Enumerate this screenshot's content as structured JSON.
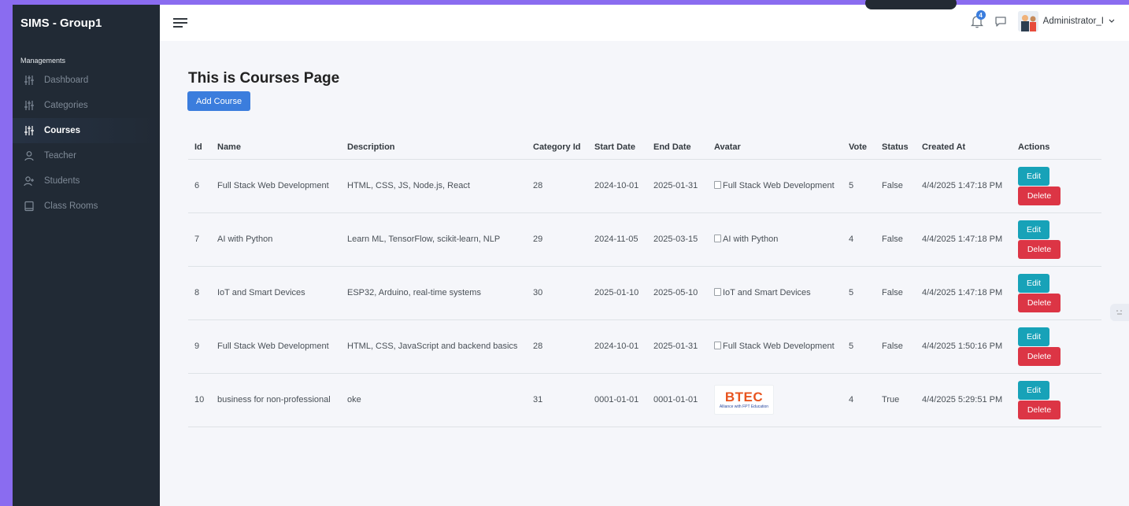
{
  "sidebar": {
    "brand": "SIMS - Group1",
    "section_label": "Managements",
    "items": [
      {
        "label": "Dashboard",
        "icon": "sliders-icon",
        "active": false
      },
      {
        "label": "Categories",
        "icon": "sliders-icon",
        "active": false
      },
      {
        "label": "Courses",
        "icon": "sliders-icon",
        "active": true
      },
      {
        "label": "Teacher",
        "icon": "user-icon",
        "active": false
      },
      {
        "label": "Students",
        "icon": "user-plus-icon",
        "active": false
      },
      {
        "label": "Class Rooms",
        "icon": "book-icon",
        "active": false
      }
    ]
  },
  "topbar": {
    "notification_count": "4",
    "user_name": "Administrator_I"
  },
  "main": {
    "title": "This is Courses Page",
    "add_button": "Add Course",
    "table": {
      "headers": [
        "Id",
        "Name",
        "Description",
        "Category Id",
        "Start Date",
        "End Date",
        "Avatar",
        "Vote",
        "Status",
        "Created At",
        "Actions"
      ],
      "rows": [
        {
          "id": "6",
          "name": "Full Stack Web Development",
          "description": "HTML, CSS, JS, Node.js, React",
          "category_id": "28",
          "start_date": "2024-10-01",
          "end_date": "2025-01-31",
          "avatar_alt": "Full Stack Web Development",
          "vote": "5",
          "status": "False",
          "created_at": "4/4/2025 1:47:18 PM"
        },
        {
          "id": "7",
          "name": "AI with Python",
          "description": "Learn ML, TensorFlow, scikit-learn, NLP",
          "category_id": "29",
          "start_date": "2024-11-05",
          "end_date": "2025-03-15",
          "avatar_alt": "AI with Python",
          "vote": "4",
          "status": "False",
          "created_at": "4/4/2025 1:47:18 PM"
        },
        {
          "id": "8",
          "name": "IoT and Smart Devices",
          "description": "ESP32, Arduino, real-time systems",
          "category_id": "30",
          "start_date": "2025-01-10",
          "end_date": "2025-05-10",
          "avatar_alt": "IoT and Smart Devices",
          "vote": "5",
          "status": "False",
          "created_at": "4/4/2025 1:47:18 PM"
        },
        {
          "id": "9",
          "name": "Full Stack Web Development",
          "description": "HTML, CSS, JavaScript and backend basics",
          "category_id": "28",
          "start_date": "2024-10-01",
          "end_date": "2025-01-31",
          "avatar_alt": "Full Stack Web Development",
          "vote": "5",
          "status": "False",
          "created_at": "4/4/2025 1:50:16 PM"
        },
        {
          "id": "10",
          "name": "business for non-professional",
          "description": "oke",
          "category_id": "31",
          "start_date": "0001-01-01",
          "end_date": "0001-01-01",
          "avatar_logo": "BTEC",
          "avatar_logo_sub": "Alliance with FPT Education",
          "vote": "4",
          "status": "True",
          "created_at": "4/4/2025 5:29:51 PM"
        }
      ],
      "edit_label": "Edit",
      "delete_label": "Delete"
    }
  },
  "colors": {
    "sidebar_bg": "#212a35",
    "primary": "#3b7ddd",
    "edit": "#17a2b8",
    "delete": "#dc3545",
    "frame": "#8a6cf0"
  }
}
